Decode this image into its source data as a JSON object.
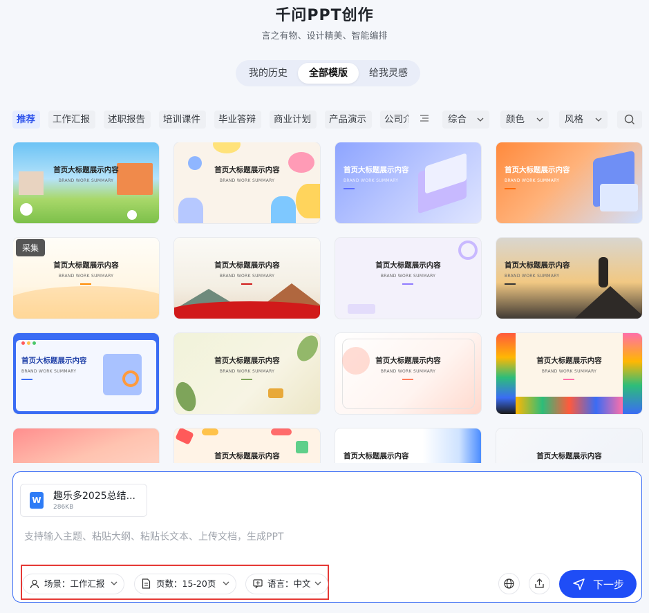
{
  "header": {
    "title": "千问PPT创作",
    "subtitle": "言之有物、设计精美、智能编排"
  },
  "tabs": {
    "history": "我的历史",
    "all": "全部模版",
    "inspire": "给我灵感"
  },
  "categories": {
    "c0": "推荐",
    "c1": "工作汇报",
    "c2": "述职报告",
    "c3": "培训课件",
    "c4": "毕业答辩",
    "c5": "商业计划",
    "c6": "产品演示",
    "c7": "公司介"
  },
  "filters": {
    "sort": "综合",
    "color": "颜色",
    "style": "风格"
  },
  "template_title": "首页大标题展示内容",
  "template_sub": "BRAND WORK SUMMARY",
  "badge": "采集",
  "input": {
    "file_name": "趣乐多2025总结...",
    "file_size": "286KB",
    "placeholder": "支持输入主题、粘贴大纲、粘贴长文本、上传文档，生成PPT"
  },
  "options": {
    "scene": "场景：工作汇报",
    "pages": "页数：15-20页",
    "language": "语言：中文"
  },
  "next_label": "下一步",
  "colors": {
    "accent": "#1f4df6",
    "highlight_box": "#e53935"
  }
}
